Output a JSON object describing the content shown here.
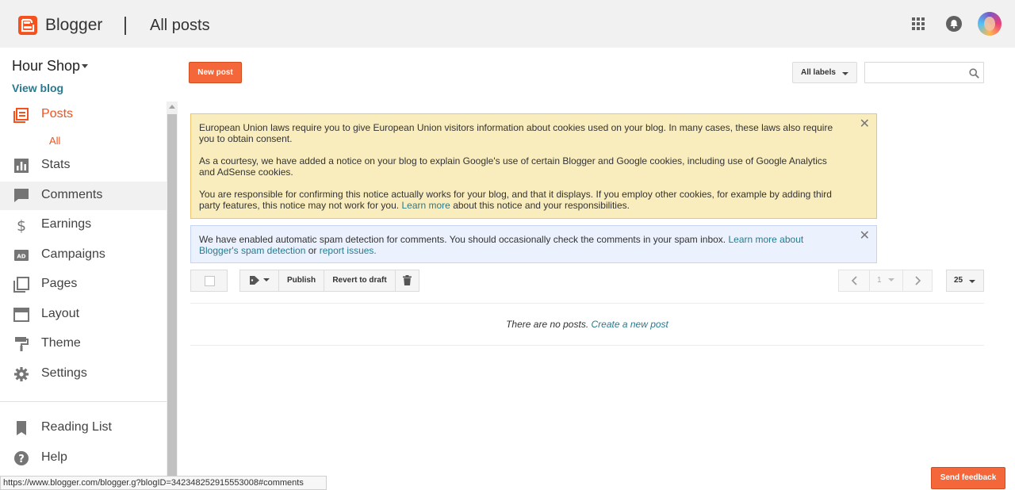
{
  "header": {
    "brand": "Blogger",
    "page_title": "All posts"
  },
  "sidebar": {
    "blog_name": "Hour Shop",
    "view_blog": "View blog",
    "items": [
      {
        "label": "Posts",
        "icon": "posts-icon"
      },
      {
        "label": "Stats",
        "icon": "stats-icon"
      },
      {
        "label": "Comments",
        "icon": "comments-icon"
      },
      {
        "label": "Earnings",
        "icon": "dollar-icon"
      },
      {
        "label": "Campaigns",
        "icon": "campaigns-icon"
      },
      {
        "label": "Pages",
        "icon": "pages-icon"
      },
      {
        "label": "Layout",
        "icon": "layout-icon"
      },
      {
        "label": "Theme",
        "icon": "paint-roller-icon"
      },
      {
        "label": "Settings",
        "icon": "gear-icon"
      }
    ],
    "posts_sub": "All",
    "bottom_items": [
      {
        "label": "Reading List",
        "icon": "bookmark-icon"
      },
      {
        "label": "Help",
        "icon": "help-icon"
      }
    ]
  },
  "toolbar": {
    "new_post": "New post",
    "labels_filter": "All labels",
    "search_value": ""
  },
  "notices": {
    "cookie_p1": "European Union laws require you to give European Union visitors information about cookies used on your blog. In many cases, these laws also require you to obtain consent.",
    "cookie_p2": "As a courtesy, we have added a notice on your blog to explain Google's use of certain Blogger and Google cookies, including use of Google Analytics and AdSense cookies.",
    "cookie_p3": "You are responsible for confirming this notice actually works for your blog, and that it displays. If you employ other cookies, for example by adding third party features, this notice may not work for you.",
    "cookie_learn_more": "Learn more",
    "cookie_p3_tail": "about this notice and your responsibilities.",
    "spam_text": "We have enabled automatic spam detection for comments. You should occasionally check the comments in your spam inbox.",
    "spam_link": "Learn more about Blogger's spam detection",
    "spam_or": "or",
    "spam_report": "report issues."
  },
  "actions": {
    "publish": "Publish",
    "revert": "Revert to draft",
    "page_num": "1",
    "per_page": "25"
  },
  "empty_state": {
    "text": "There are no posts.",
    "link": "Create a new post"
  },
  "status_url": "https://www.blogger.com/blogger.g?blogID=3423482529155530​08#comments",
  "feedback": "Send feedback",
  "colors": {
    "accent": "#f4511e",
    "link": "#277a90",
    "cookie_bg": "#f9edbe",
    "spam_bg": "#ebf1fd"
  }
}
